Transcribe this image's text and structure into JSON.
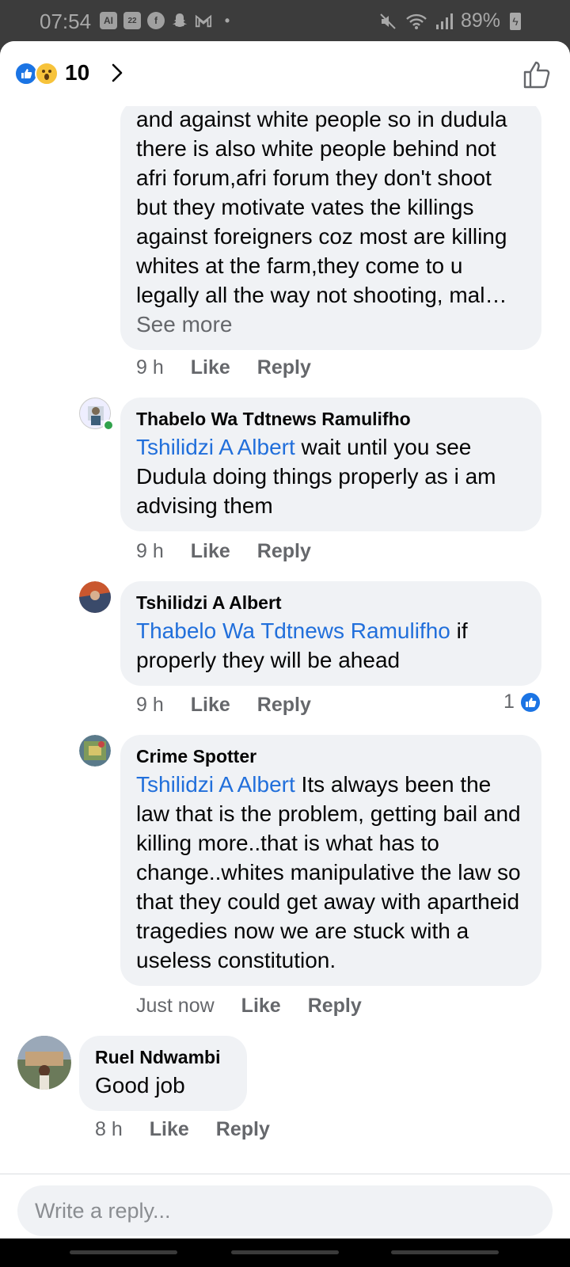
{
  "status_bar": {
    "time": "07:54",
    "notification_icons": [
      "ai-icon",
      "calendar-icon",
      "facebook-icon",
      "snapchat-icon",
      "gmail-icon",
      "dot-icon"
    ],
    "calendar_day": "22",
    "ai_label": "AI",
    "battery": "89%"
  },
  "header": {
    "reactions": [
      "like",
      "wow"
    ],
    "reaction_count": "10"
  },
  "comments": [
    {
      "id": "c0",
      "text": "and against white people so in dudula there is also white people behind not afri forum,afri forum they don't shoot but they motivate vates the killings against foreigners coz most are killing whites at the farm,they come to u legally all the way not shooting, mal…",
      "see_more": " See more",
      "time": "9 h",
      "like": "Like",
      "reply": "Reply"
    },
    {
      "id": "c1",
      "author": "Thabelo Wa Tdtnews Ramulifho",
      "mention": "Tshilidzi A Albert",
      "text": " wait until you see Dudula doing things properly as i am advising them",
      "time": "9 h",
      "like": "Like",
      "reply": "Reply"
    },
    {
      "id": "c2",
      "author": "Tshilidzi A Albert",
      "mention": "Thabelo Wa Tdtnews Ramulifho",
      "text": " if properly they will be ahead",
      "time": "9 h",
      "like": "Like",
      "reply": "Reply",
      "reaction_count": "1"
    },
    {
      "id": "c3",
      "author": "Crime Spotter",
      "mention": "Tshilidzi A Albert",
      "text": " Its always been the law that is the problem, getting bail and killing more..that is what has to change..whites manipulative the law so that they could get away with apartheid tragedies now we are stuck with a useless constitution.",
      "time": "Just now",
      "like": "Like",
      "reply": "Reply"
    },
    {
      "id": "c4",
      "author": "Ruel Ndwambi",
      "text": "Good job",
      "time": "8 h",
      "like": "Like",
      "reply": "Reply"
    }
  ],
  "composer": {
    "placeholder": "Write a reply..."
  },
  "colors": {
    "accent": "#1b74e4",
    "mention": "#216fdb",
    "bubble": "#f0f2f5",
    "meta": "#65676b"
  }
}
